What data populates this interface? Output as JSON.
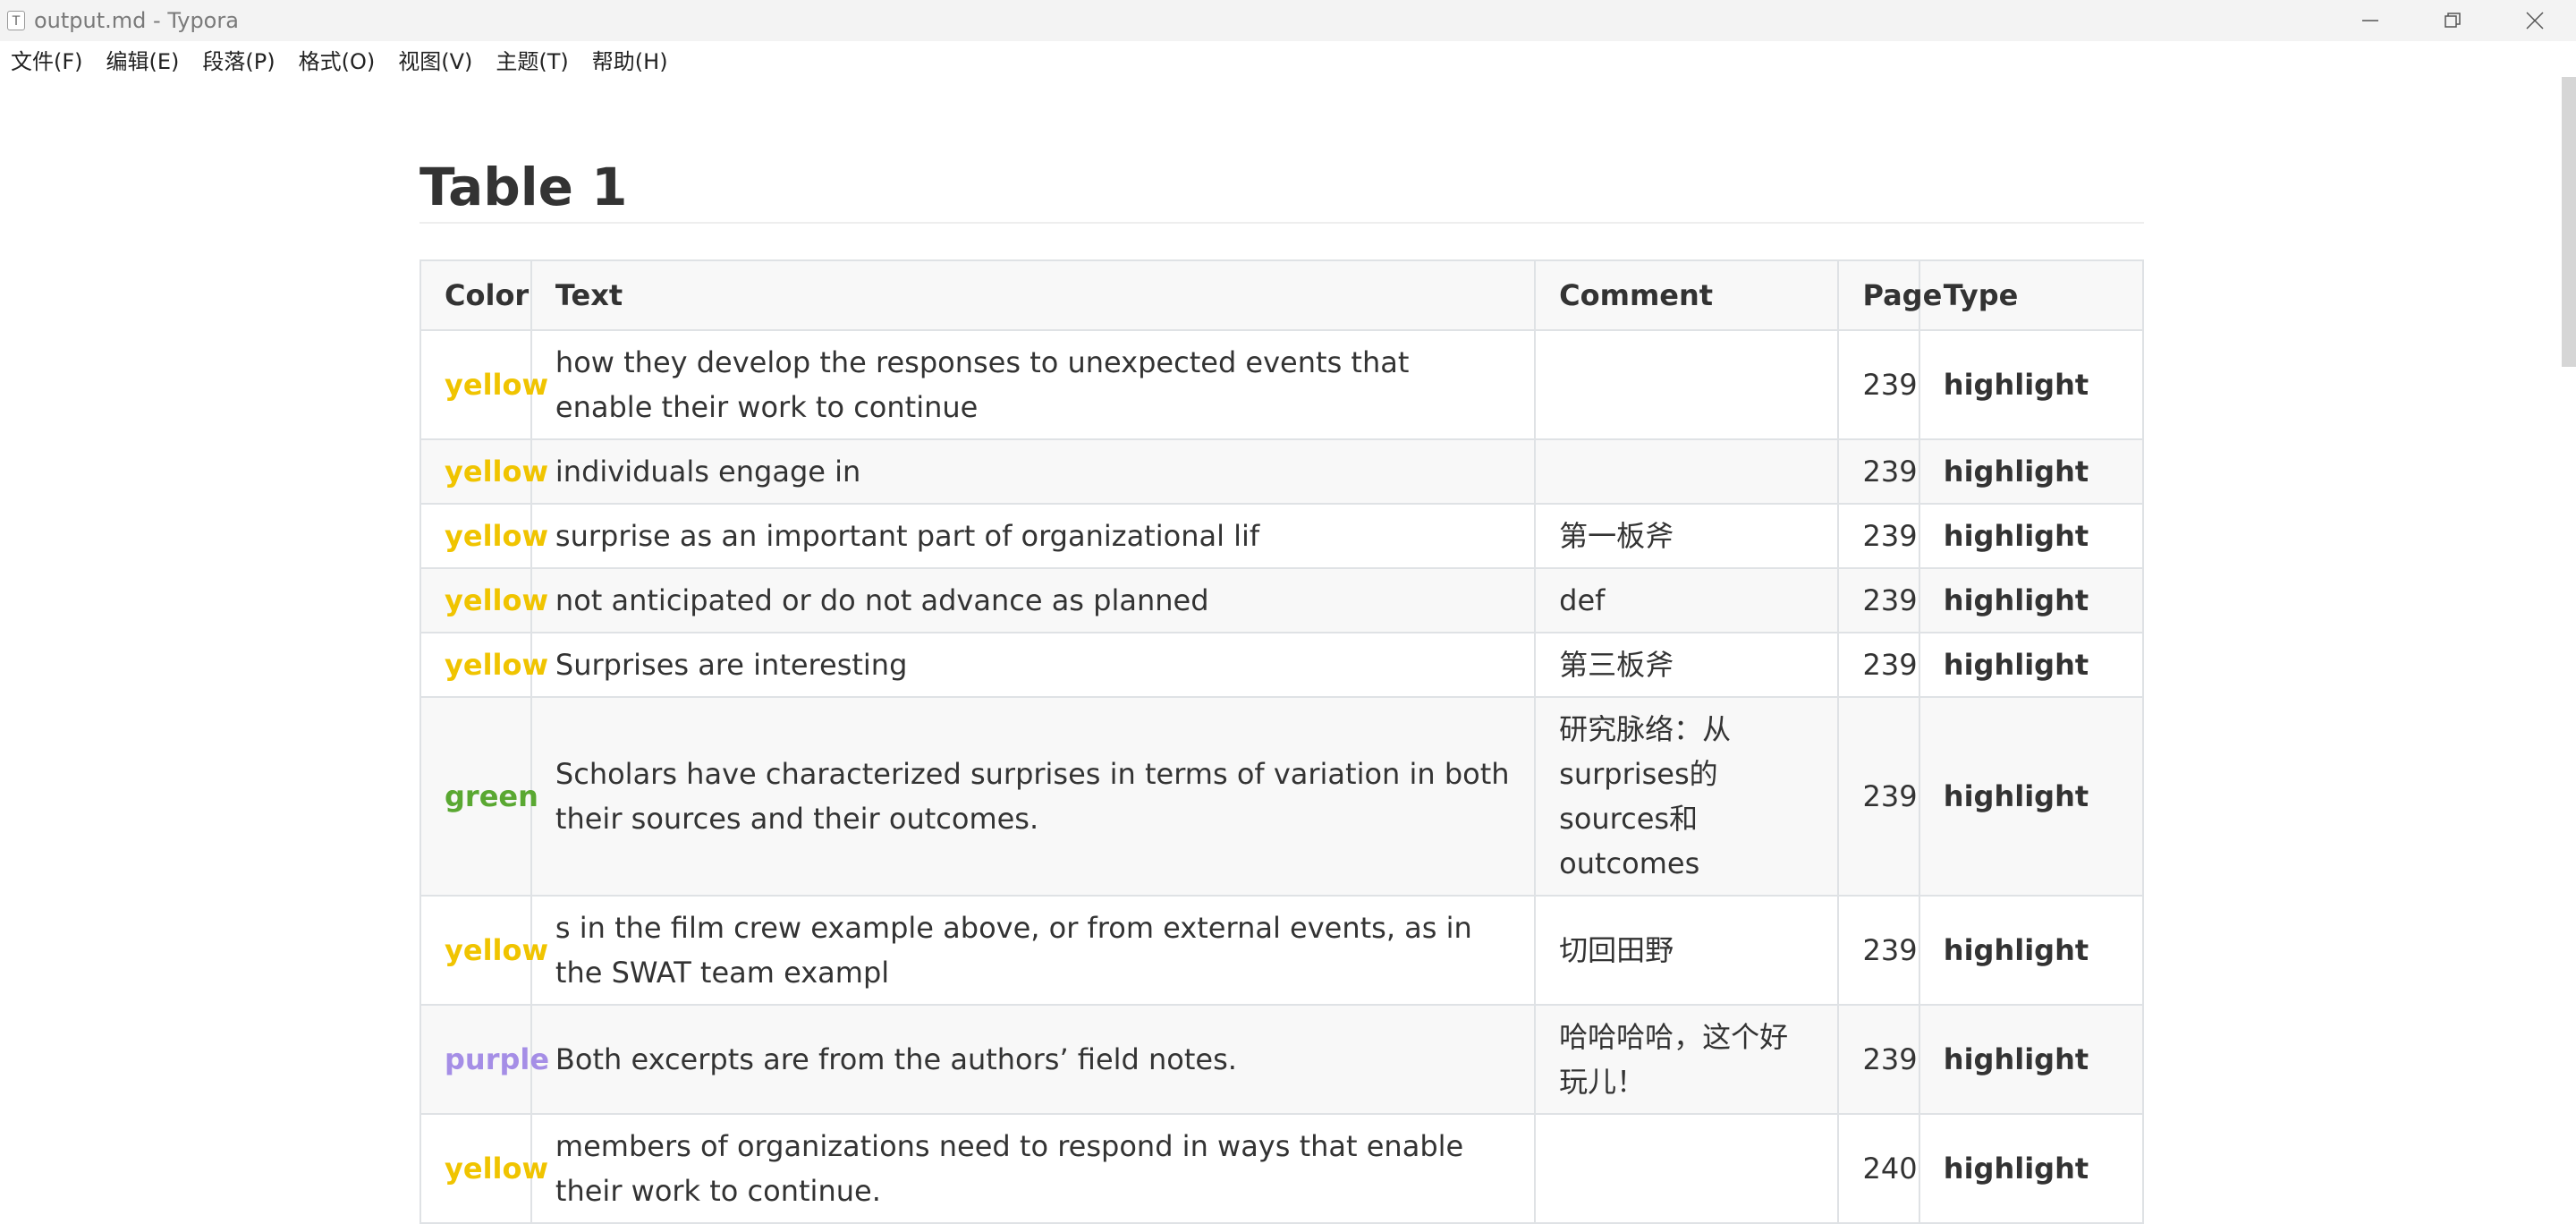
{
  "window": {
    "title": "output.md - Typora",
    "icon_letter": "T"
  },
  "menu": {
    "items": [
      "文件(F)",
      "编辑(E)",
      "段落(P)",
      "格式(O)",
      "视图(V)",
      "主题(T)",
      "帮助(H)"
    ]
  },
  "document": {
    "heading": "Table 1",
    "columns": [
      "Color",
      "Text",
      "Comment",
      "Page",
      "Type"
    ],
    "rows": [
      {
        "color": "yellow",
        "color_hex": "#f0c400",
        "text": "how they develop the responses to unexpected events that enable their work to continue",
        "comment": "",
        "page": "239",
        "type": "highlight"
      },
      {
        "color": "yellow",
        "color_hex": "#f0c400",
        "text": "individuals engage in",
        "comment": "",
        "page": "239",
        "type": "highlight"
      },
      {
        "color": "yellow",
        "color_hex": "#f0c400",
        "text": "surprise as an important part of organizational lif",
        "comment": "第一板斧",
        "page": "239",
        "type": "highlight"
      },
      {
        "color": "yellow",
        "color_hex": "#f0c400",
        "text": "not anticipated or do not advance as planned",
        "comment": "def",
        "page": "239",
        "type": "highlight"
      },
      {
        "color": "yellow",
        "color_hex": "#f0c400",
        "text": "Surprises are interesting",
        "comment": "第三板斧",
        "page": "239",
        "type": "highlight"
      },
      {
        "color": "green",
        "color_hex": "#5aa832",
        "text": "Scholars have characterized surprises in terms of variation in both their sources and their outcomes.",
        "comment": "研究脉络：从surprises的sources和outcomes",
        "page": "239",
        "type": "highlight"
      },
      {
        "color": "yellow",
        "color_hex": "#f0c400",
        "text": "s in the film crew example above, or from external events, as in the SWAT team exampl",
        "comment": "切回田野",
        "page": "239",
        "type": "highlight"
      },
      {
        "color": "purple",
        "color_hex": "#a58ee6",
        "text": "Both excerpts are from the authors’ field notes.",
        "comment": "哈哈哈哈，这个好玩儿！",
        "page": "239",
        "type": "highlight"
      },
      {
        "color": "yellow",
        "color_hex": "#f0c400",
        "text": "members of organizations need to respond in ways that enable their work to continue.",
        "comment": "",
        "page": "240",
        "type": "highlight"
      }
    ]
  }
}
